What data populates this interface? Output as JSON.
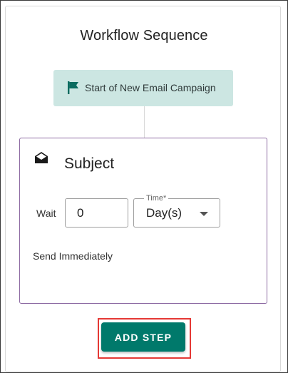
{
  "workflow": {
    "title": "Workflow Sequence",
    "start_node": {
      "label": "Start of New Email Campaign",
      "icon": "flag-icon"
    },
    "step": {
      "icon": "envelope-open-icon",
      "title": "Subject",
      "wait_label": "Wait",
      "wait_value": "0",
      "time_label": "Time*",
      "time_value": "Day(s)",
      "description": "Send Immediately"
    },
    "add_step_label": "ADD STEP"
  },
  "colors": {
    "accent": "#00796b",
    "start_node_bg": "#cce6e2",
    "step_border": "#8d6ba3",
    "highlight": "#e53935"
  }
}
